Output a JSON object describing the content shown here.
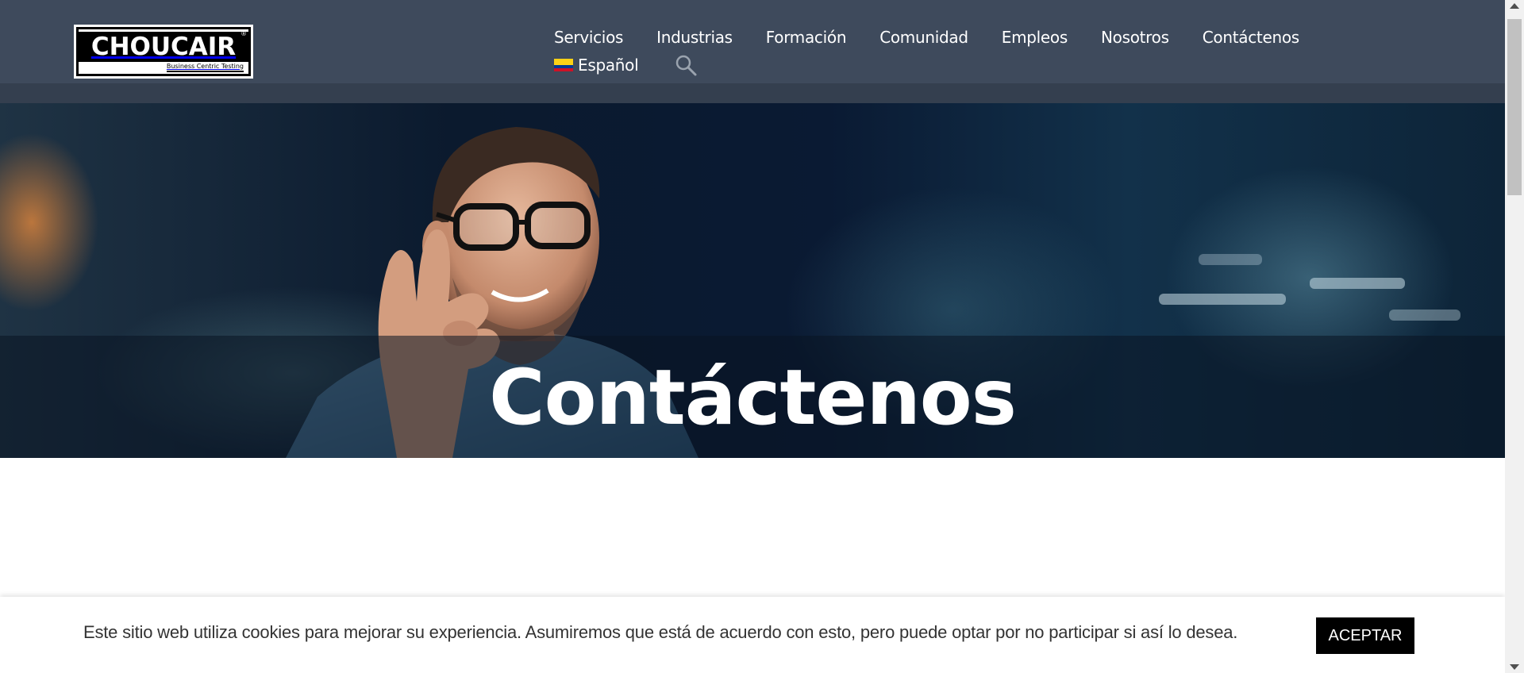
{
  "brand": {
    "logo_text": "CHOUCAIR",
    "logo_tagline": "Business Centric Testing",
    "logo_mark": "®"
  },
  "nav": {
    "items": [
      {
        "label": "Servicios"
      },
      {
        "label": "Industrias"
      },
      {
        "label": "Formación"
      },
      {
        "label": "Comunidad"
      },
      {
        "label": "Empleos"
      },
      {
        "label": "Nosotros"
      },
      {
        "label": "Contáctenos"
      }
    ],
    "language": "Español",
    "language_flag_icon": "colombia-flag-icon",
    "search_icon": "search-icon"
  },
  "hero": {
    "title": "Contáctenos"
  },
  "cookie_banner": {
    "text": "Este sitio web utiliza cookies para mejorar su experiencia. Asumiremos que está de acuerdo con esto, pero puede optar por no participar si así lo desea.",
    "accept_label": "ACEPTAR"
  },
  "colors": {
    "header_bg": "#3e4a5c",
    "accept_bg": "#000000"
  }
}
